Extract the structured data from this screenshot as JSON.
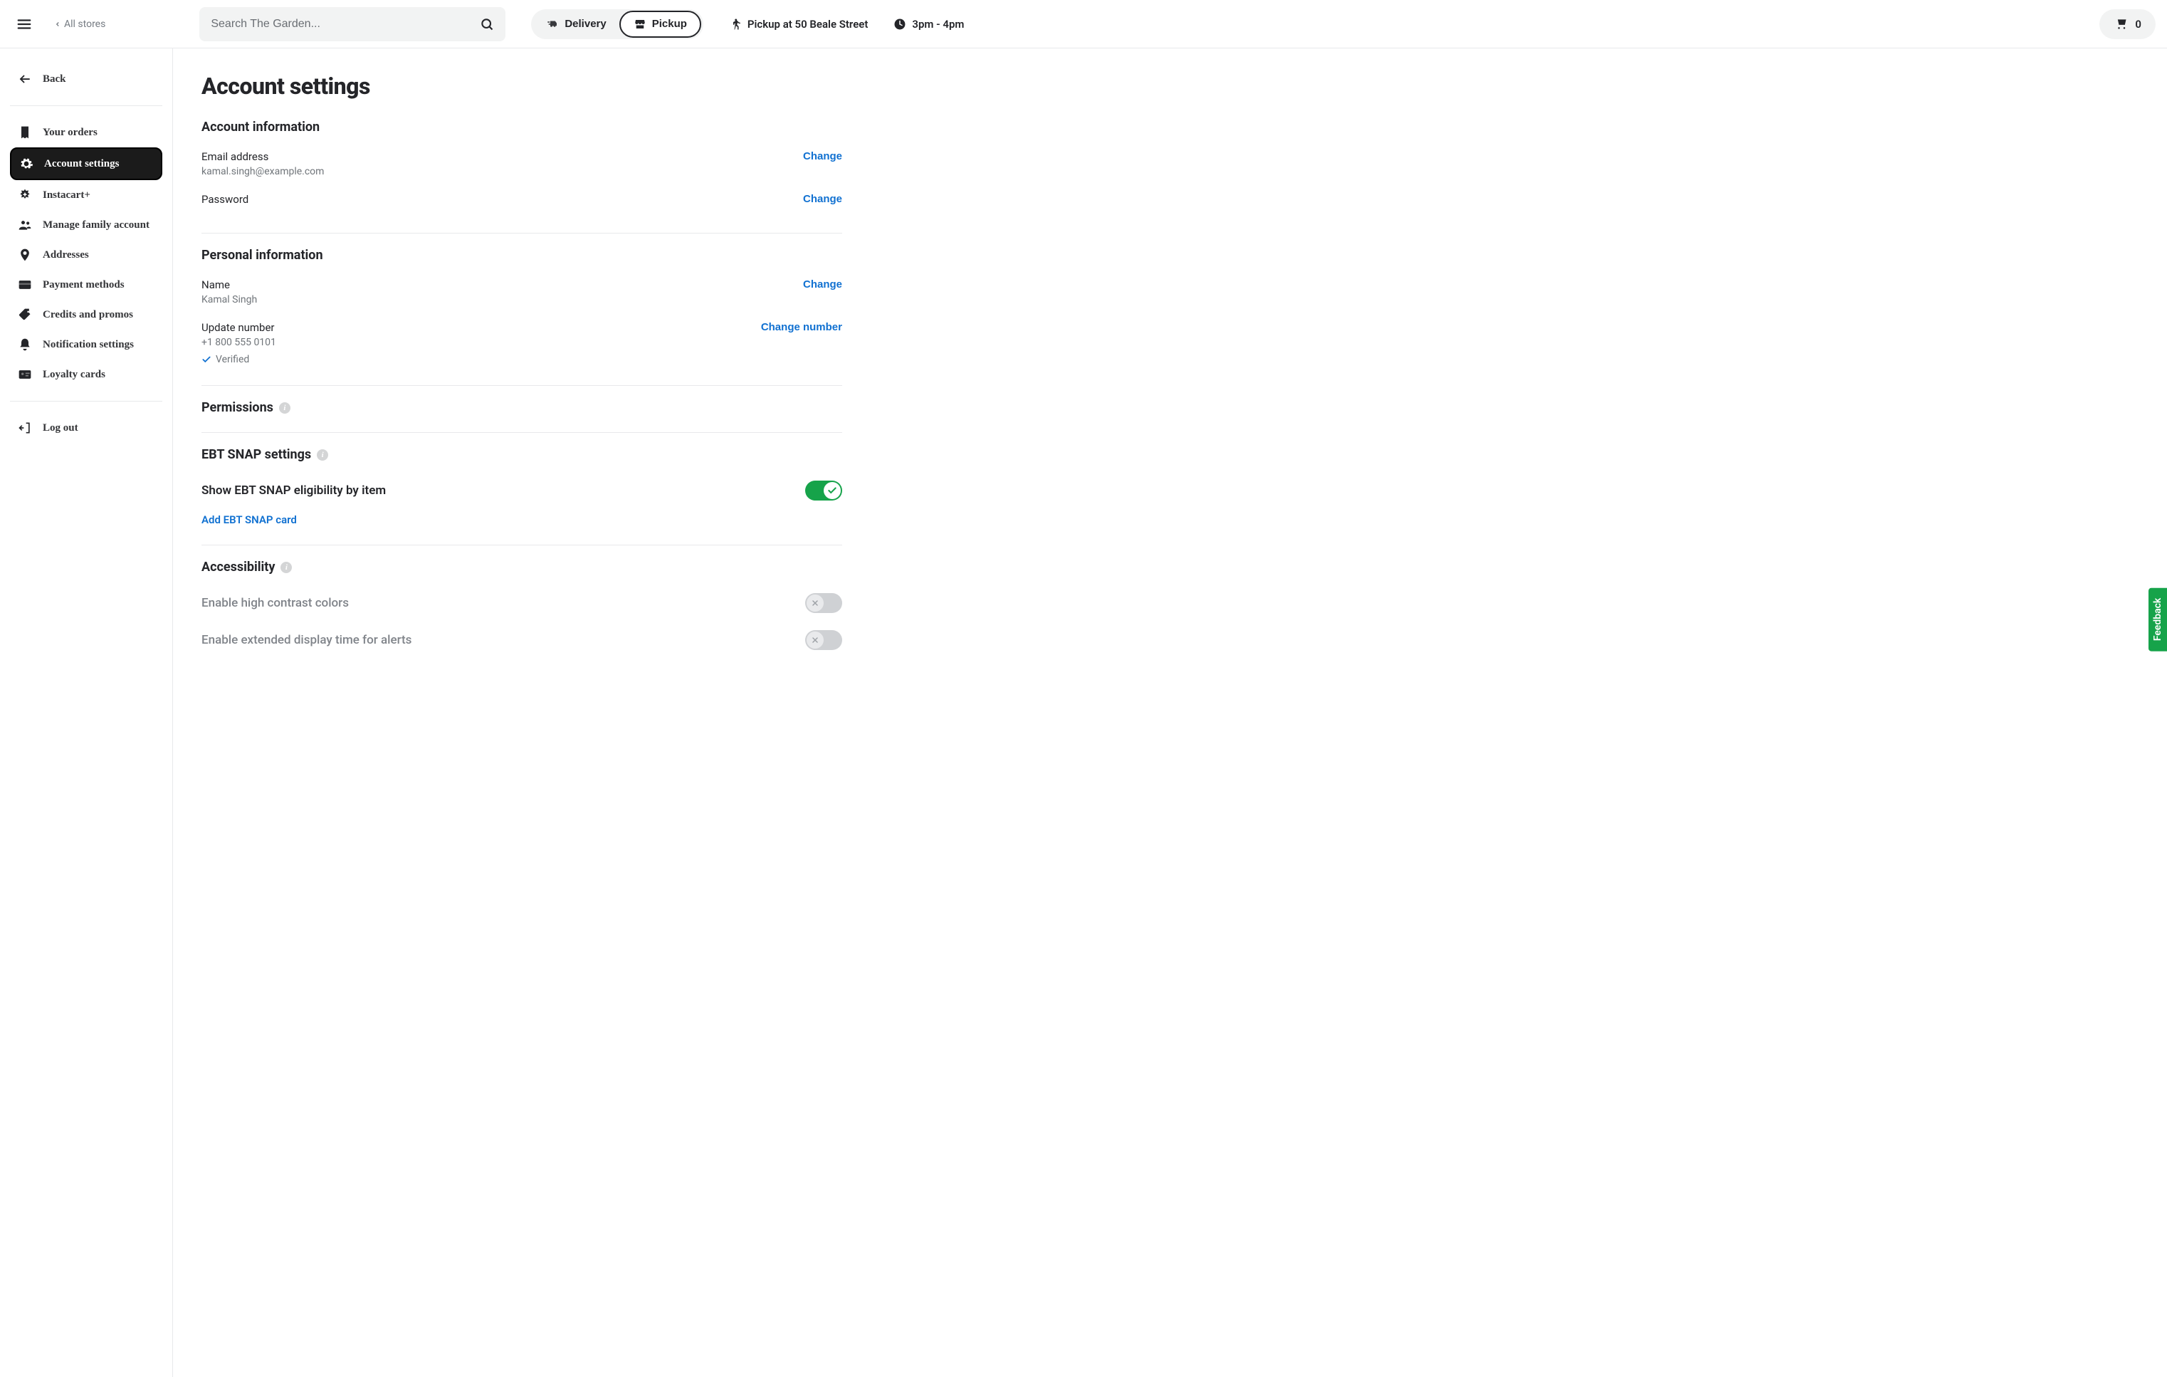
{
  "header": {
    "all_stores": "All stores",
    "search_placeholder": "Search The Garden...",
    "delivery": "Delivery",
    "pickup": "Pickup",
    "pickup_location": "Pickup at 50 Beale Street",
    "time_window": "3pm - 4pm",
    "cart_count": "0"
  },
  "sidebar": {
    "back": "Back",
    "items": [
      {
        "label": "Your orders",
        "icon": "receipt-icon"
      },
      {
        "label": "Account settings",
        "icon": "gear-icon"
      },
      {
        "label": "Instacart+",
        "icon": "plus-badge-icon"
      },
      {
        "label": "Manage family account",
        "icon": "people-icon"
      },
      {
        "label": "Addresses",
        "icon": "location-pin-icon"
      },
      {
        "label": "Payment methods",
        "icon": "card-icon"
      },
      {
        "label": "Credits and promos",
        "icon": "tag-icon"
      },
      {
        "label": "Notification settings",
        "icon": "bell-icon"
      },
      {
        "label": "Loyalty cards",
        "icon": "id-card-icon"
      }
    ],
    "logout": "Log out"
  },
  "page": {
    "title": "Account settings",
    "account_info": {
      "heading": "Account information",
      "email_label": "Email address",
      "email_value": "kamal.singh@example.com",
      "password_label": "Password",
      "change": "Change"
    },
    "personal_info": {
      "heading": "Personal information",
      "name_label": "Name",
      "name_value": "Kamal Singh",
      "phone_label": "Update number",
      "phone_value": "+1 800 555 0101",
      "verified": "Verified",
      "change": "Change",
      "change_number": "Change number"
    },
    "permissions": {
      "heading": "Permissions"
    },
    "ebt": {
      "heading": "EBT SNAP settings",
      "show_label": "Show EBT SNAP eligibility by item",
      "add_card": "Add EBT SNAP card"
    },
    "accessibility": {
      "heading": "Accessibility",
      "high_contrast": "Enable high contrast colors",
      "extended_time": "Enable extended display time for alerts"
    }
  },
  "feedback": "Feedback"
}
